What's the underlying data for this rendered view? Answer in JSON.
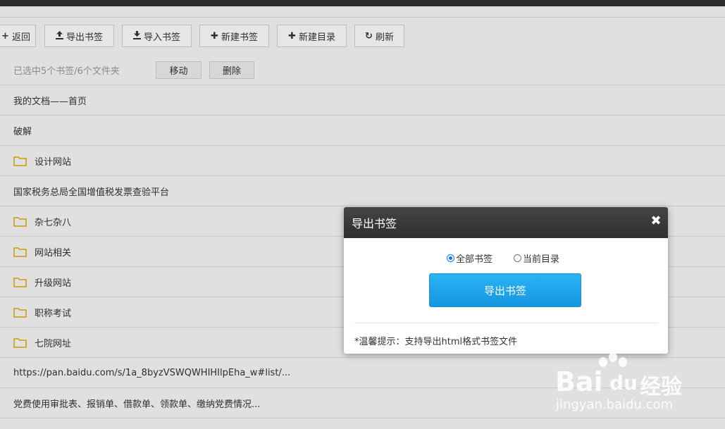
{
  "toolbar": {
    "back": "返回",
    "export": "导出书签",
    "import": "导入书签",
    "new_bookmark": "新建书签",
    "new_folder": "新建目录",
    "refresh": "刷新"
  },
  "selection": {
    "text": "已选中5个书签/6个文件夹",
    "move": "移动",
    "delete": "删除"
  },
  "rows": [
    {
      "type": "bookmark",
      "label": "我的文档——首页"
    },
    {
      "type": "bookmark",
      "label": "破解"
    },
    {
      "type": "folder",
      "label": "设计网站"
    },
    {
      "type": "bookmark",
      "label": "国家税务总局全国增值税发票查验平台"
    },
    {
      "type": "folder",
      "label": "杂七杂八"
    },
    {
      "type": "folder",
      "label": "网站相关"
    },
    {
      "type": "folder",
      "label": "升级网站"
    },
    {
      "type": "folder",
      "label": "职称考试"
    },
    {
      "type": "folder",
      "label": "七院网址"
    },
    {
      "type": "bookmark",
      "label": "https://pan.baidu.com/s/1a_8byzVSWQWHIHIlpEha_w#list/..."
    },
    {
      "type": "bookmark",
      "label": "党费使用审批表、报销单、借款单、领款单、缴纳党费情况..."
    }
  ],
  "modal": {
    "title": "导出书签",
    "options": [
      "全部书签",
      "当前目录"
    ],
    "selected": "全部书签",
    "button": "导出书签",
    "tip": "*温馨提示：支持导出html格式书签文件"
  },
  "watermark": {
    "brand_a": "Bai",
    "brand_b": "du",
    "brand_cn": "经验",
    "url": "jingyan.baidu.com"
  },
  "colors": {
    "folder": "#e0a800",
    "primary": "#1a9be6",
    "header": "#333333"
  }
}
